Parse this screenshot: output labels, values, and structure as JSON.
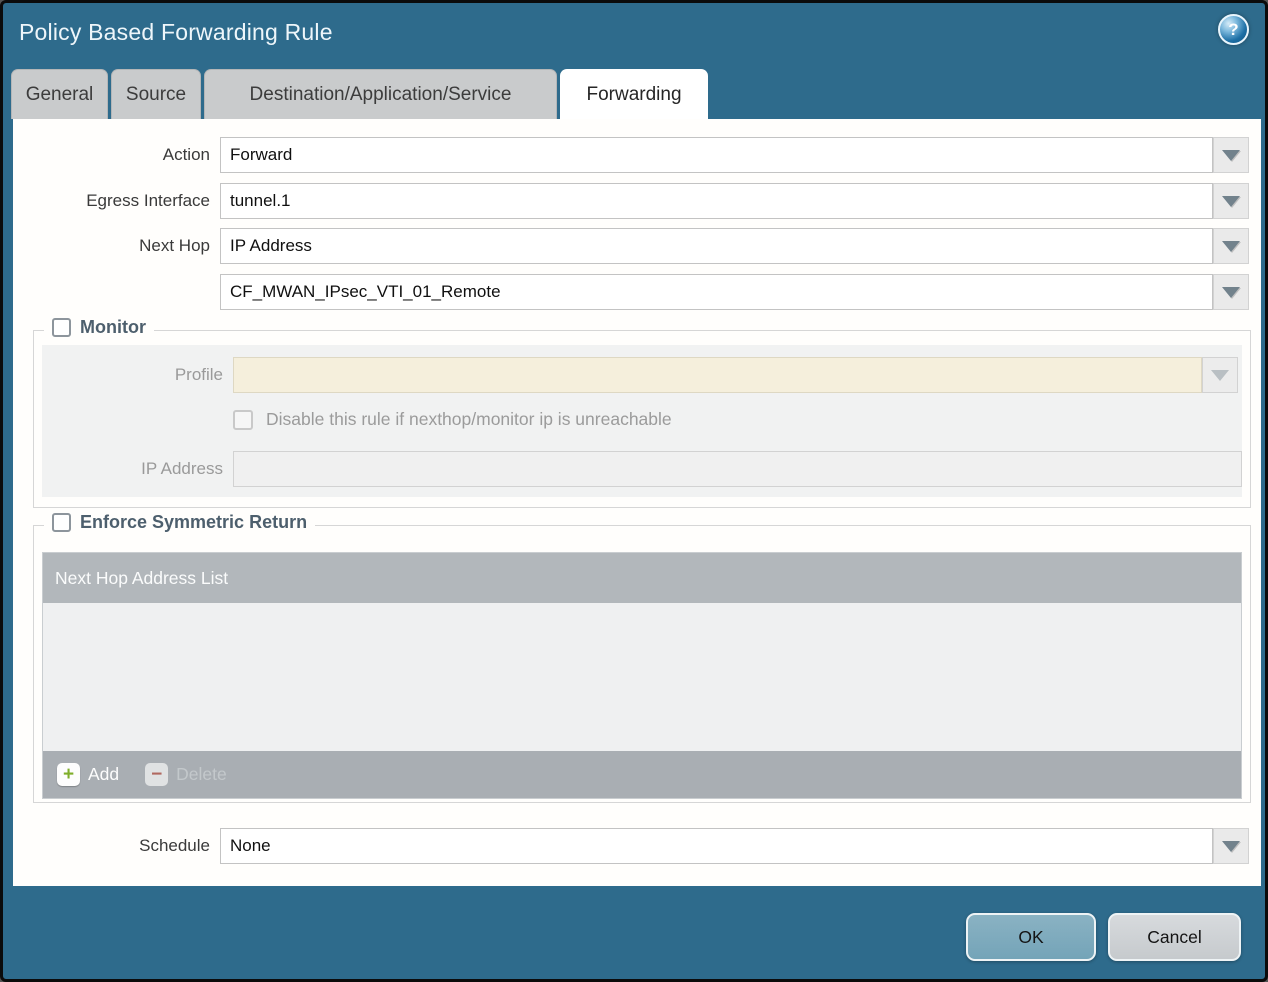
{
  "dialog": {
    "title": "Policy Based Forwarding Rule",
    "help_glyph": "?"
  },
  "tabs": [
    {
      "label": "General",
      "active": false
    },
    {
      "label": "Source",
      "active": false
    },
    {
      "label": "Destination/Application/Service",
      "active": false
    },
    {
      "label": "Forwarding",
      "active": true
    }
  ],
  "form": {
    "action": {
      "label": "Action",
      "value": "Forward"
    },
    "egress_interface": {
      "label": "Egress Interface",
      "value": "tunnel.1"
    },
    "next_hop": {
      "label": "Next Hop",
      "value": "IP Address"
    },
    "next_hop_value": {
      "value": "CF_MWAN_IPsec_VTI_01_Remote"
    },
    "schedule": {
      "label": "Schedule",
      "value": "None"
    }
  },
  "monitor": {
    "title": "Monitor",
    "checked": false,
    "profile": {
      "label": "Profile",
      "value": ""
    },
    "disable_rule_checkbox": {
      "label": "Disable this rule if nexthop/monitor ip is unreachable",
      "checked": false
    },
    "ip_address": {
      "label": "IP Address",
      "value": ""
    }
  },
  "symmetric_return": {
    "title": "Enforce Symmetric Return",
    "checked": false,
    "table": {
      "header": "Next Hop Address List",
      "rows": [],
      "add_label": "Add",
      "delete_label": "Delete"
    }
  },
  "footer": {
    "ok_label": "OK",
    "cancel_label": "Cancel"
  },
  "colors": {
    "titlebar_bg": "#2e6b8c",
    "tab_inactive_bg": "#c9cbcc",
    "accent_section_title": "#4d5f6d",
    "table_header_bg": "#b2b7bb",
    "table_footer_bg": "#a9aeb3",
    "table_body_bg": "#eff0f1",
    "disabled_field_bg": "#f5efdc",
    "ok_button_bg": "#74a4b8",
    "cancel_button_bg": "#c6cacd",
    "add_icon_color": "#7fae2a",
    "delete_icon_color": "#b0685f"
  }
}
